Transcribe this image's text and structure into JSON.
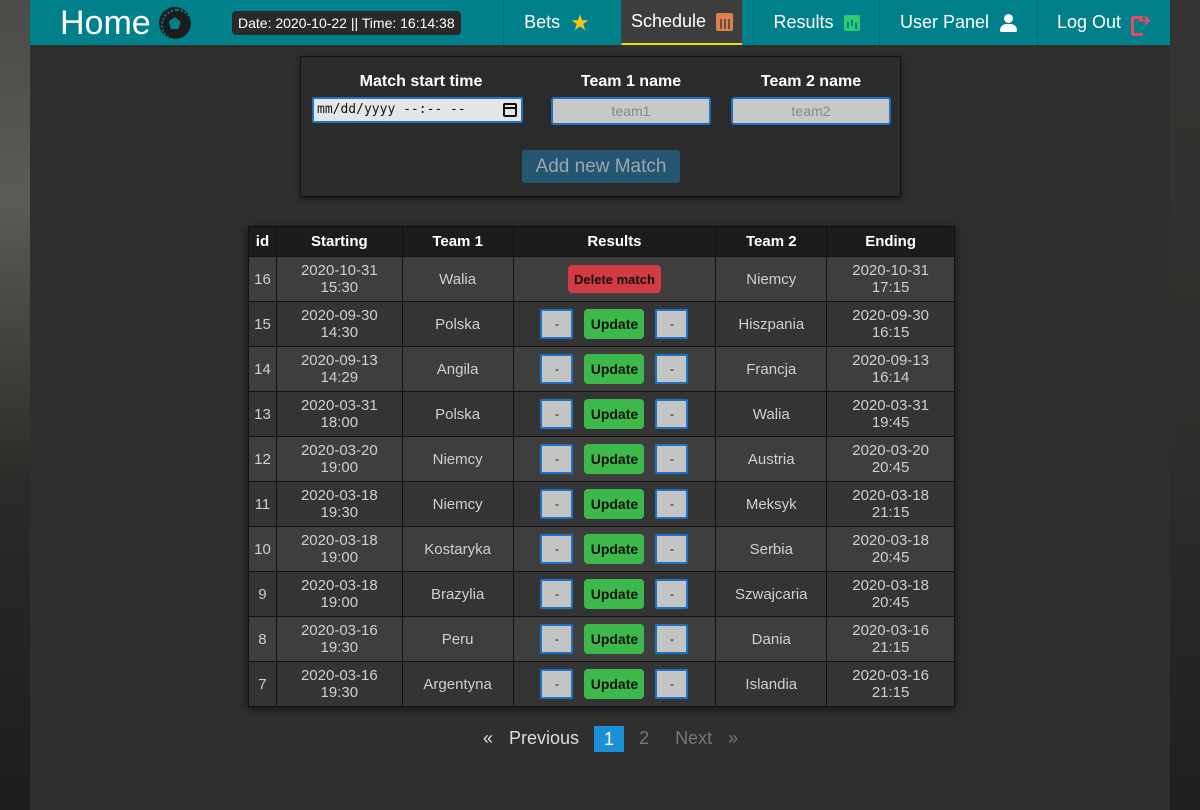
{
  "navbar": {
    "brand": "Home",
    "datetime": "Date: 2020-10-22 || Time: 16:14:38",
    "items": [
      {
        "label": "Bets",
        "icon": "star-icon"
      },
      {
        "label": "Schedule",
        "icon": "calendar-icon",
        "active": true
      },
      {
        "label": "Results",
        "icon": "chart-icon"
      },
      {
        "label": "User Panel",
        "icon": "user-icon"
      },
      {
        "label": "Log Out",
        "icon": "logout-icon"
      }
    ]
  },
  "form": {
    "start_label": "Match start time",
    "start_value": "mm/dd/yyyy --:-- --",
    "team1_label": "Team 1 name",
    "team1_placeholder": "team1",
    "team2_label": "Team 2 name",
    "team2_placeholder": "team2",
    "submit_label": "Add new Match"
  },
  "table": {
    "headers": [
      "id",
      "Starting",
      "Team 1",
      "Results",
      "Team 2",
      "Ending"
    ],
    "update_label": "Update",
    "delete_label": "Delete match",
    "score_placeholder": "-",
    "rows": [
      {
        "id": "16",
        "start_date": "2020-10-31",
        "start_time": "15:30",
        "team1": "Walia",
        "team2": "Niemcy",
        "end_date": "2020-10-31",
        "end_time": "17:15",
        "action": "delete"
      },
      {
        "id": "15",
        "start_date": "2020-09-30",
        "start_time": "14:30",
        "team1": "Polska",
        "team2": "Hiszpania",
        "end_date": "2020-09-30",
        "end_time": "16:15",
        "action": "update"
      },
      {
        "id": "14",
        "start_date": "2020-09-13",
        "start_time": "14:29",
        "team1": "Angila",
        "team2": "Francja",
        "end_date": "2020-09-13",
        "end_time": "16:14",
        "action": "update"
      },
      {
        "id": "13",
        "start_date": "2020-03-31",
        "start_time": "18:00",
        "team1": "Polska",
        "team2": "Walia",
        "end_date": "2020-03-31",
        "end_time": "19:45",
        "action": "update"
      },
      {
        "id": "12",
        "start_date": "2020-03-20",
        "start_time": "19:00",
        "team1": "Niemcy",
        "team2": "Austria",
        "end_date": "2020-03-20",
        "end_time": "20:45",
        "action": "update"
      },
      {
        "id": "11",
        "start_date": "2020-03-18",
        "start_time": "19:30",
        "team1": "Niemcy",
        "team2": "Meksyk",
        "end_date": "2020-03-18",
        "end_time": "21:15",
        "action": "update"
      },
      {
        "id": "10",
        "start_date": "2020-03-18",
        "start_time": "19:00",
        "team1": "Kostaryka",
        "team2": "Serbia",
        "end_date": "2020-03-18",
        "end_time": "20:45",
        "action": "update"
      },
      {
        "id": "9",
        "start_date": "2020-03-18",
        "start_time": "19:00",
        "team1": "Brazylia",
        "team2": "Szwajcaria",
        "end_date": "2020-03-18",
        "end_time": "20:45",
        "action": "update"
      },
      {
        "id": "8",
        "start_date": "2020-03-16",
        "start_time": "19:30",
        "team1": "Peru",
        "team2": "Dania",
        "end_date": "2020-03-16",
        "end_time": "21:15",
        "action": "update"
      },
      {
        "id": "7",
        "start_date": "2020-03-16",
        "start_time": "19:30",
        "team1": "Argentyna",
        "team2": "Islandia",
        "end_date": "2020-03-16",
        "end_time": "21:15",
        "action": "update"
      }
    ]
  },
  "pagination": {
    "first": "«",
    "prev": "Previous",
    "pages": [
      "1",
      "2"
    ],
    "current": "1",
    "next": "Next",
    "last": "»"
  },
  "colors": {
    "navbar": "#00808a",
    "update_button": "#3cb94a",
    "delete_button": "#d33b44",
    "active_page": "#1c8fd4"
  }
}
